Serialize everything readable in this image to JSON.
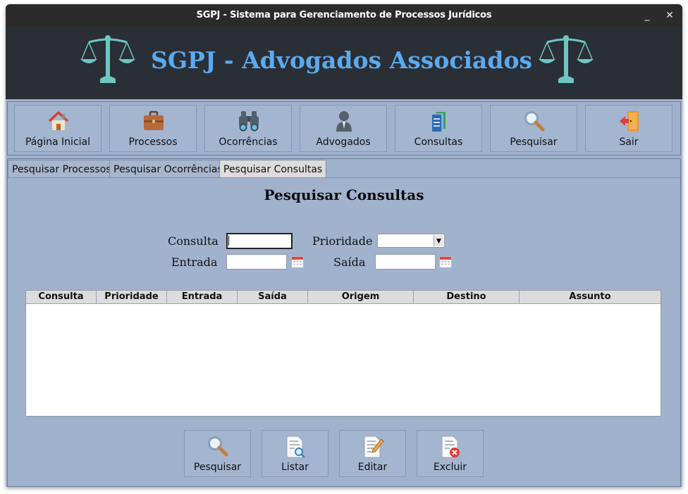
{
  "window": {
    "title": "SGPJ - Sistema para Gerenciamento de Processos Jurídicos",
    "minimize_glyph": "_",
    "close_glyph": "✕"
  },
  "banner": {
    "title": "SGPJ - Advogados Associados",
    "icon": "scales-of-justice-icon",
    "accent": "#5aaaf0"
  },
  "nav": {
    "items": [
      {
        "label": "Página Inicial",
        "icon": "home-icon"
      },
      {
        "label": "Processos",
        "icon": "briefcase-icon"
      },
      {
        "label": "Ocorrências",
        "icon": "binoculars-icon"
      },
      {
        "label": "Advogados",
        "icon": "user-icon"
      },
      {
        "label": "Consultas",
        "icon": "documents-icon"
      },
      {
        "label": "Pesquisar",
        "icon": "search-icon"
      },
      {
        "label": "Sair",
        "icon": "exit-door-icon"
      }
    ]
  },
  "tabs": [
    {
      "label": "Pesquisar Processos",
      "active": false
    },
    {
      "label": "Pesquisar Ocorrências",
      "active": false
    },
    {
      "label": "Pesquisar Consultas",
      "active": true
    }
  ],
  "form": {
    "title": "Pesquisar Consultas",
    "consulta_label": "Consulta",
    "consulta_value": "",
    "prioridade_label": "Prioridade",
    "prioridade_value": "",
    "entrada_label": "Entrada",
    "entrada_value": "",
    "saida_label": "Saída",
    "saida_value": ""
  },
  "table": {
    "columns": [
      "Consulta",
      "Prioridade",
      "Entrada",
      "Saída",
      "Origem",
      "Destino",
      "Assunto"
    ],
    "rows": []
  },
  "actions": [
    {
      "label": "Pesquisar",
      "icon": "search-icon"
    },
    {
      "label": "Listar",
      "icon": "document-search-icon"
    },
    {
      "label": "Editar",
      "icon": "document-edit-icon"
    },
    {
      "label": "Excluir",
      "icon": "document-delete-icon"
    }
  ],
  "colors": {
    "panel": "#a1b2cd",
    "titlebar": "#2b2b2b",
    "banner": "#2a2e35"
  }
}
